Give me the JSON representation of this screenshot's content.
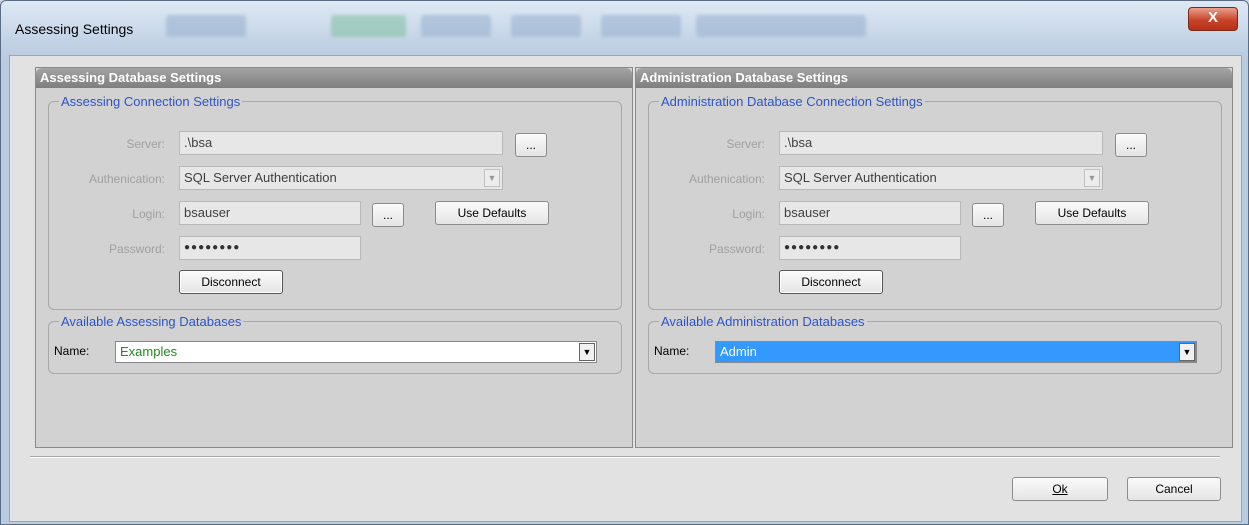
{
  "window": {
    "title": "Assessing Settings",
    "close_glyph": "X"
  },
  "assessing": {
    "header": "Assessing Database  Settings",
    "connection_legend": "Assessing Connection Settings",
    "server_label": "Server:",
    "server_value": ".\\bsa",
    "browse_label": "...",
    "auth_label": "Authenication:",
    "auth_value": "SQL Server Authentication",
    "login_label": "Login:",
    "login_value": "bsauser",
    "use_defaults_label": "Use Defaults",
    "password_label": "Password:",
    "password_value": "●●●●●●●●",
    "disconnect_label": "Disconnect",
    "databases_legend": "Available Assessing Databases",
    "name_label": "Name:",
    "name_value": "Examples"
  },
  "administration": {
    "header": "Administration Database Settings",
    "connection_legend": "Administration Database Connection Settings",
    "server_label": "Server:",
    "server_value": ".\\bsa",
    "browse_label": "...",
    "auth_label": "Authenication:",
    "auth_value": "SQL Server Authentication",
    "login_label": "Login:",
    "login_value": "bsauser",
    "use_defaults_label": "Use Defaults",
    "password_label": "Password:",
    "password_value": "●●●●●●●●",
    "disconnect_label": "Disconnect",
    "databases_legend": "Available Administration Databases",
    "name_label": "Name:",
    "name_value": "Admin"
  },
  "footer": {
    "ok_label": "Ok",
    "cancel_label": "Cancel"
  },
  "colors": {
    "legend_blue": "#2c55c9",
    "selected_blue": "#3399ff",
    "examples_green": "#1f8a1f"
  }
}
